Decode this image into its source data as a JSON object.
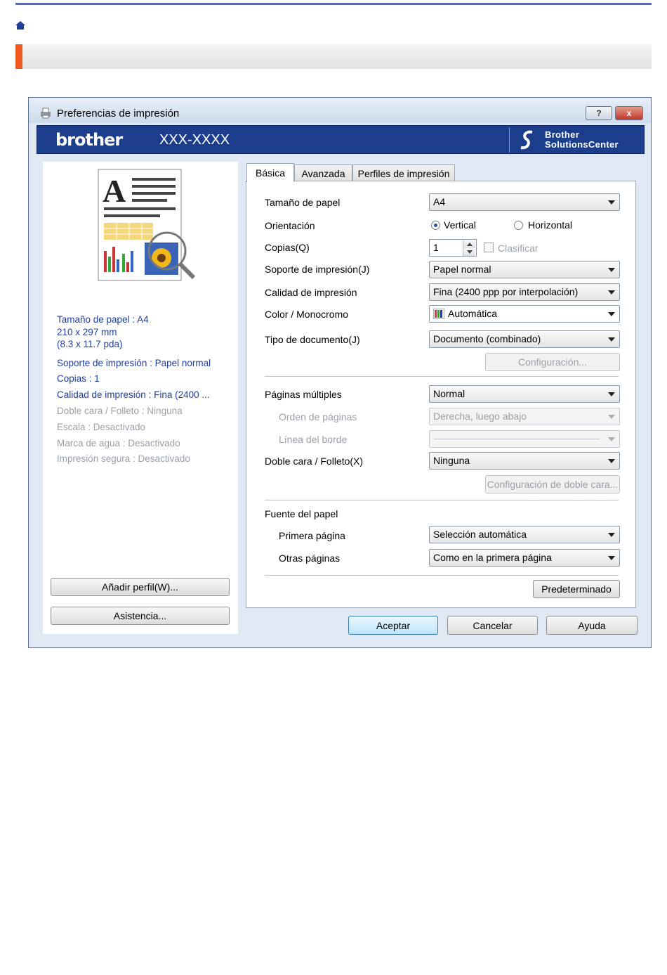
{
  "header": {
    "home_icon": "home-icon",
    "accent_color": "#f05a22",
    "line_color": "#5a6bb0"
  },
  "dialog": {
    "title": "Preferencias de impresión",
    "help_button": "?",
    "close_button": "x"
  },
  "banner": {
    "logo": "brother",
    "model": "XXX-XXXX",
    "solutions_center": [
      "Brother",
      "SolutionsCenter"
    ]
  },
  "summary": {
    "paper_size": "Tamaño de papel : A4",
    "dims_mm": "210 x 297 mm",
    "dims_in": "(8.3 x 11.7 pda)",
    "media": "Soporte de impresión : Papel normal",
    "copies": "Copias : 1",
    "quality": "Calidad de impresión : Fina (2400 ...",
    "duplex": "Doble cara / Folleto : Ninguna",
    "scale": "Escala : Desactivado",
    "watermark": "Marca de agua : Desactivado",
    "secure": "Impresión segura : Desactivado"
  },
  "left_buttons": {
    "add_profile": "Añadir perfil(W)...",
    "support": "Asistencia..."
  },
  "tabs": [
    "Básica",
    "Avanzada",
    "Perfiles de impresión"
  ],
  "form": {
    "paper_size": {
      "label": "Tamaño de papel",
      "value": "A4"
    },
    "orientation": {
      "label": "Orientación",
      "vertical": "Vertical",
      "horizontal": "Horizontal"
    },
    "copies": {
      "label": "Copias(Q)",
      "value": "1",
      "collate": "Clasificar"
    },
    "media": {
      "label": "Soporte de impresión(J)",
      "value": "Papel normal"
    },
    "quality": {
      "label": "Calidad de impresión",
      "value": "Fina (2400 ppp por interpolación)"
    },
    "color": {
      "label": "Color / Monocromo",
      "value": "Automática"
    },
    "doc_type": {
      "label": "Tipo de documento(J)",
      "value": "Documento (combinado)"
    },
    "config_button": "Configuración...",
    "multi_page": {
      "label": "Páginas múltiples",
      "value": "Normal"
    },
    "page_order": {
      "label": "Orden de páginas",
      "value": "Derecha, luego abajo"
    },
    "border_line": {
      "label": "Línea del borde"
    },
    "duplex": {
      "label": "Doble cara / Folleto(X)",
      "value": "Ninguna"
    },
    "duplex_config_button": "Configuración de doble cara...",
    "paper_source": {
      "label": "Fuente del papel"
    },
    "first_page": {
      "label": "Primera página",
      "value": "Selección automática"
    },
    "other_pages": {
      "label": "Otras páginas",
      "value": "Como en la primera página"
    },
    "default_button": "Predeterminado"
  },
  "footer": {
    "ok": "Aceptar",
    "cancel": "Cancelar",
    "help": "Ayuda"
  }
}
